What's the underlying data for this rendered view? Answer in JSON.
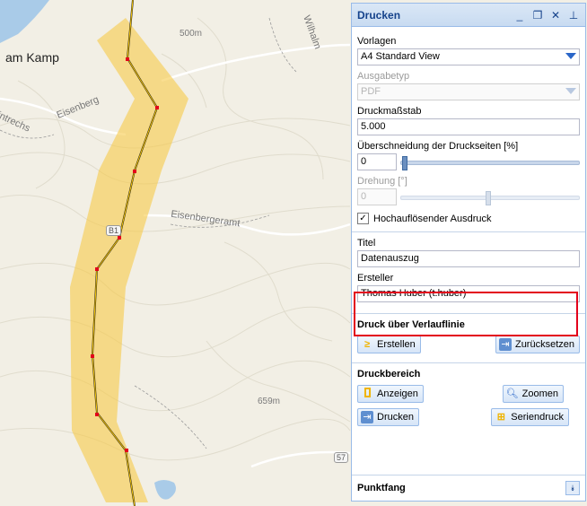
{
  "map": {
    "labels": {
      "place": "am Kamp",
      "elev_500": "500m",
      "eisenberg": "Eisenberg",
      "entrechs": "intrechs",
      "eisenbergeramt": "Eisenbergeramt",
      "road_shield": "B1",
      "wilhalm": "Wilhalm",
      "elev_659": "659m",
      "road_57": "57"
    }
  },
  "panel": {
    "title": "Drucken",
    "tools": {
      "minimize": "_",
      "restore": "❐",
      "close": "✕",
      "pin": "⊥"
    },
    "vorlagen": {
      "label": "Vorlagen",
      "value": "A4 Standard View"
    },
    "ausgabetyp": {
      "label": "Ausgabetyp",
      "value": "PDF"
    },
    "druckmassstab": {
      "label": "Druckmaßstab",
      "value": "5.000"
    },
    "ueberschneidung": {
      "label": "Überschneidung der Druckseiten [%]",
      "value": "0"
    },
    "drehung": {
      "label": "Drehung [°]",
      "value": "0"
    },
    "hochaufloesend": {
      "label": "Hochauflösender Ausdruck",
      "checked": "✓"
    },
    "titel": {
      "label": "Titel",
      "value": "Datenauszug"
    },
    "ersteller": {
      "label": "Ersteller",
      "value": "Thomas Huber (t.huber)"
    },
    "verlauflinie": {
      "title": "Druck über Verlauflinie",
      "erstellen": "Erstellen",
      "zuruecksetzen": "Zurücksetzen"
    },
    "druckbereich": {
      "title": "Druckbereich",
      "anzeigen": "Anzeigen",
      "zoomen": "Zoomen",
      "drucken": "Drucken",
      "seriendruck": "Seriendruck"
    },
    "punktfang": {
      "title": "Punktfang",
      "expand_icon": "double-chevron-down-icon"
    }
  },
  "colors": {
    "accent": "#15428b",
    "highlight": "#e3001b",
    "corridor": "#f7c948"
  }
}
